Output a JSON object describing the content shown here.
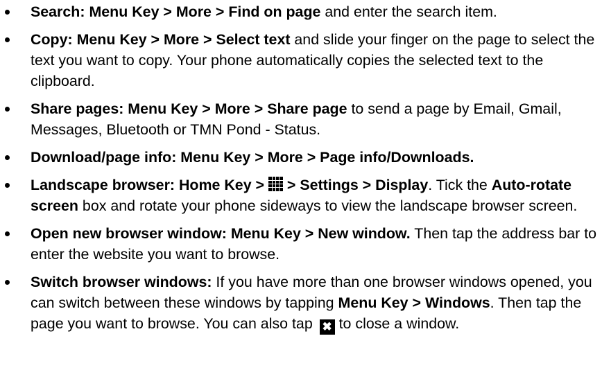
{
  "items": [
    {
      "label": "Search:",
      "path": "Menu Key > More > Find on page",
      "rest": " and enter the search item."
    },
    {
      "label": "Copy:",
      "path": "Menu Key > More > Select text",
      "rest": " and slide your finger on the page to select the text you want to copy. Your phone automatically copies the selected text to the clipboard."
    },
    {
      "label": "Share pages:",
      "path": "Menu Key > More > Share page",
      "rest": " to send a page by Email, Gmail, Messages, Bluetooth or TMN Pond - Status."
    },
    {
      "label": "Download/page info:",
      "path": "Menu Key > More > Page info/Downloads."
    },
    {
      "label": "Landscape browser:",
      "path_before_icon": "Home Key > ",
      "icon": "grid-icon",
      "path_after_icon": " > Settings > Display",
      "rest_1": ". Tick the ",
      "bold_1": "Auto-rotate screen",
      "rest_2": " box and rotate your phone sideways to view the landscape browser screen."
    },
    {
      "label": "Open new browser window:",
      "path": "Menu Key > New window.",
      "rest": " Then tap the address bar to enter the website you want to browse."
    },
    {
      "label": "Switch browser windows:",
      "rest_1": " If you have more than one browser windows opened, you can switch between these windows by tapping ",
      "bold_1": "Menu Key > Windows",
      "rest_2": ". Then tap the page you want to browse. You can also tap ",
      "icon": "close-icon",
      "icon_glyph": "✖",
      "rest_3": " to close a window."
    }
  ]
}
